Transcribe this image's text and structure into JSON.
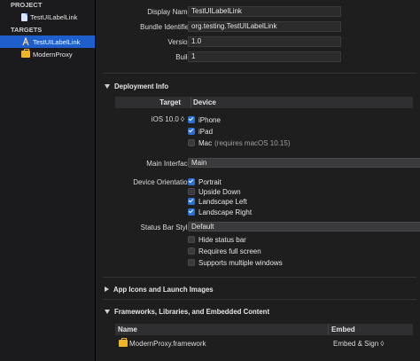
{
  "sidebar": {
    "project_header": "PROJECT",
    "project_item": "TestUILabelLink",
    "targets_header": "TARGETS",
    "targets": [
      {
        "label": "TestUILabelLink",
        "selected": true
      },
      {
        "label": "ModernProxy",
        "selected": false
      }
    ]
  },
  "identity": {
    "display_name_label": "Display Name",
    "display_name_value": "TestUILabelLink",
    "bundle_id_label": "Bundle Identifier",
    "bundle_id_value": "org.testing.TestUILabelLink",
    "version_label": "Version",
    "version_value": "1.0",
    "build_label": "Build",
    "build_value": "1"
  },
  "deployment": {
    "section_title": "Deployment Info",
    "col_target": "Target",
    "col_device": "Device",
    "ios_version": "iOS 10.0 ◊",
    "devices": [
      {
        "label": "iPhone",
        "checked": true
      },
      {
        "label": "iPad",
        "checked": true
      },
      {
        "label": "Mac",
        "note": "(requires macOS 10.15)",
        "checked": false
      }
    ],
    "main_interface_label": "Main Interface",
    "main_interface_value": "Main",
    "orientation_label": "Device Orientation",
    "orientations": [
      {
        "label": "Portrait",
        "checked": true
      },
      {
        "label": "Upside Down",
        "checked": false
      },
      {
        "label": "Landscape Left",
        "checked": true
      },
      {
        "label": "Landscape Right",
        "checked": true
      }
    ],
    "status_bar_label": "Status Bar Style",
    "status_bar_value": "Default",
    "status_options": [
      {
        "label": "Hide status bar",
        "checked": false
      },
      {
        "label": "Requires full screen",
        "checked": false
      },
      {
        "label": "Supports multiple windows",
        "checked": false
      }
    ]
  },
  "app_icons": {
    "section_title": "App Icons and Launch Images"
  },
  "frameworks": {
    "section_title": "Frameworks, Libraries, and Embedded Content",
    "col_name": "Name",
    "col_embed": "Embed",
    "rows": [
      {
        "name": "ModernProxy.framework",
        "embed": "Embed & Sign ◊"
      }
    ]
  },
  "colors": {
    "selection": "#1f5fcb",
    "checkbox": "#2a6fd6",
    "background": "#1e1e1e"
  }
}
